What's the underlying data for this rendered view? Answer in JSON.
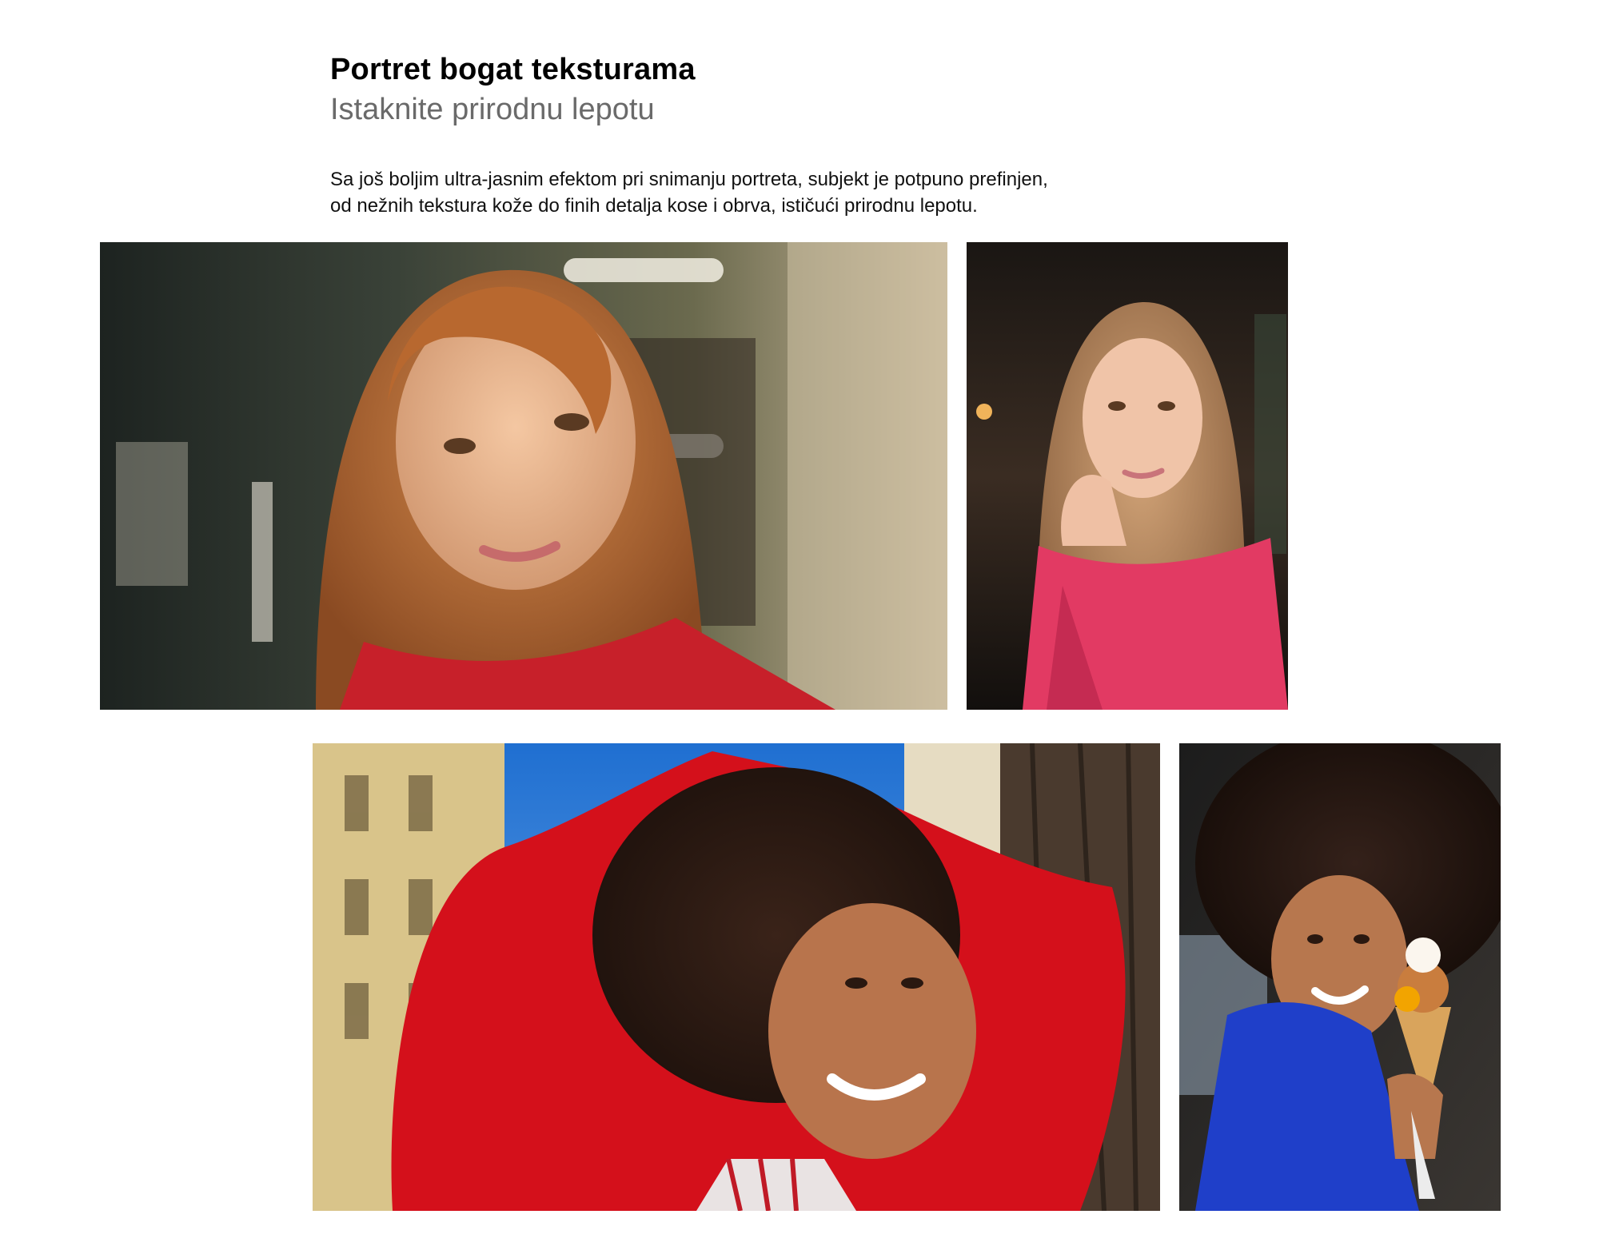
{
  "header": {
    "title": "Portret bogat teksturama",
    "subtitle": "Istaknite prirodnu lepotu"
  },
  "description": {
    "line1": "Sa još boljim ultra-jasnim efektom pri snimanju portreta, subjekt je potpuno prefinjen,",
    "line2": "od nežnih tekstura kože do finih detalja kose i obrva, ističući prirodnu lepotu."
  },
  "gallery": {
    "photos": [
      {
        "subject": "woman-with-auburn-hair-in-bar"
      },
      {
        "subject": "woman-with-blonde-hair-hand-on-chin"
      },
      {
        "subject": "woman-with-afro-in-red-sweater"
      },
      {
        "subject": "woman-with-afro-holding-ice-cream"
      }
    ]
  }
}
